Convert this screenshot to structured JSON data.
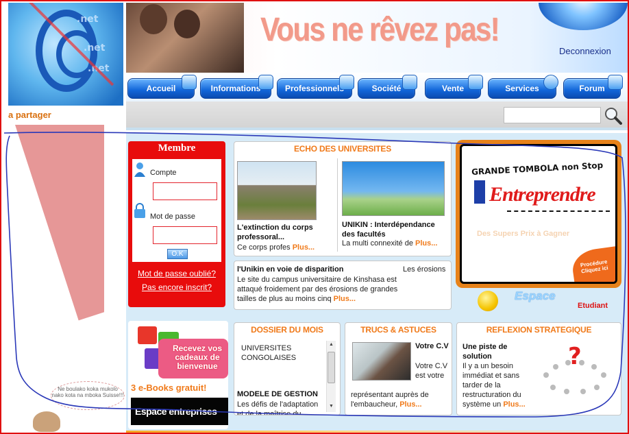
{
  "header": {
    "slogan": "Vous  ne rêvez pas!",
    "logout_label": "Deconnexion"
  },
  "left": {
    "share_text": "a partager",
    "bubble_text": "Ne boulako koka mukolo nako kota na mboka Suisse!!!"
  },
  "nav": {
    "items": [
      {
        "label": "Accueil"
      },
      {
        "label": "Informations"
      },
      {
        "label": "Professionnels"
      },
      {
        "label": "Société"
      },
      {
        "label": "Vente"
      },
      {
        "label": "Services"
      },
      {
        "label": "Forum"
      }
    ]
  },
  "search": {
    "value": ""
  },
  "member": {
    "title": "Membre",
    "account_label": "Compte",
    "password_label": "Mot de passe",
    "ok_label": "O.K",
    "forgot_link": "Mot de passe oublié?",
    "register_link": "Pas encore inscrit?"
  },
  "echo": {
    "title": "ECHO DES UNIVERSITES",
    "item1": {
      "title": "L'extinction du corps professoral...",
      "body": "Ce corps profes ",
      "more": "Plus..."
    },
    "item2": {
      "title": "UNIKIN : Interdépendance des facultés",
      "body": "La multi connexité de ",
      "more": "Plus..."
    },
    "item3": {
      "title": "l'Unikin en voie de disparition",
      "side": "Les érosions",
      "body": "Le site du campus universitaire de Kinshasa est attaqué froidement par des érosions de grandes tailles de plus au moins cinq ",
      "more": "Plus..."
    }
  },
  "tombola": {
    "headline": "GRANDE TOMBOLA non Stop",
    "brand": "Entreprendre",
    "prizes": "Des Supers Prix à Gagner",
    "cta": "Procédure Cliquez ici",
    "espace": "Espace",
    "etudiant": "Etudiant"
  },
  "promo": {
    "gift_text": "Recevez vos cadeaux de bienvenue",
    "ebooks": "3 e-Books gratuit!",
    "espace_entreprises": "Espace entreprises"
  },
  "dossier": {
    "title": "DOSSIER DU MOIS",
    "item1": "UNIVERSITES CONGOLAISES",
    "item2_title": "MODELE DE GESTION",
    "item2_body": "Les défis de l'adaptation et de la maîtrise du"
  },
  "trucs": {
    "title": "TRUCS & ASTUCES",
    "heading": "Votre C.V",
    "body_side": "Votre C.V est votre",
    "body": "représentant auprès de l'embaucheur, ",
    "more": "Plus..."
  },
  "reflexion": {
    "title": "REFLEXION STRATEGIQUE",
    "heading": "Une piste de solution",
    "body": "Il y a un besoin immédiat et sans tarder de la restructuration du système un ",
    "more": "Plus..."
  }
}
